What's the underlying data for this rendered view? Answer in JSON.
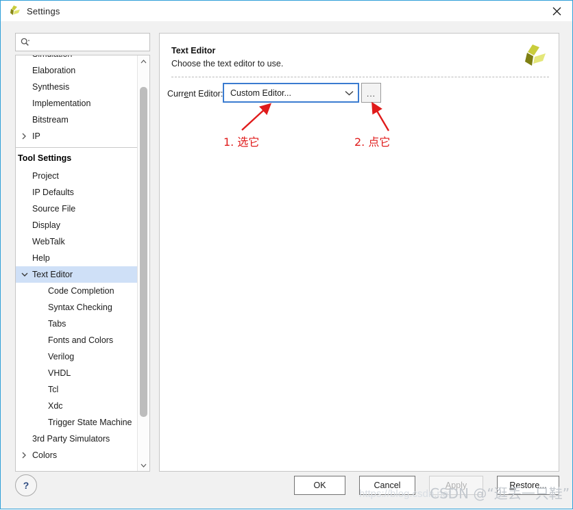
{
  "window": {
    "title": "Settings",
    "logo_icon": "vivado-logo-icon",
    "close_icon": "close-icon",
    "accent_color": "#2f9fd8"
  },
  "search": {
    "icon": "search-icon",
    "value": "",
    "placeholder": ""
  },
  "sidebar": {
    "items": [
      {
        "label": "Simulation",
        "level": 1,
        "type": "item",
        "chevron": "",
        "selected": false
      },
      {
        "label": "Elaboration",
        "level": 1,
        "type": "item",
        "chevron": "",
        "selected": false
      },
      {
        "label": "Synthesis",
        "level": 1,
        "type": "item",
        "chevron": "",
        "selected": false
      },
      {
        "label": "Implementation",
        "level": 1,
        "type": "item",
        "chevron": "",
        "selected": false
      },
      {
        "label": "Bitstream",
        "level": 1,
        "type": "item",
        "chevron": "",
        "selected": false
      },
      {
        "label": "IP",
        "level": 1,
        "type": "item",
        "chevron": "right",
        "selected": false
      },
      {
        "label": "Tool Settings",
        "level": 0,
        "type": "header",
        "chevron": "",
        "selected": false
      },
      {
        "label": "Project",
        "level": 1,
        "type": "item",
        "chevron": "",
        "selected": false
      },
      {
        "label": "IP Defaults",
        "level": 1,
        "type": "item",
        "chevron": "",
        "selected": false
      },
      {
        "label": "Source File",
        "level": 1,
        "type": "item",
        "chevron": "",
        "selected": false
      },
      {
        "label": "Display",
        "level": 1,
        "type": "item",
        "chevron": "",
        "selected": false
      },
      {
        "label": "WebTalk",
        "level": 1,
        "type": "item",
        "chevron": "",
        "selected": false
      },
      {
        "label": "Help",
        "level": 1,
        "type": "item",
        "chevron": "",
        "selected": false
      },
      {
        "label": "Text Editor",
        "level": 1,
        "type": "item",
        "chevron": "down",
        "selected": true
      },
      {
        "label": "Code Completion",
        "level": 2,
        "type": "item",
        "chevron": "",
        "selected": false
      },
      {
        "label": "Syntax Checking",
        "level": 2,
        "type": "item",
        "chevron": "",
        "selected": false
      },
      {
        "label": "Tabs",
        "level": 2,
        "type": "item",
        "chevron": "",
        "selected": false
      },
      {
        "label": "Fonts and Colors",
        "level": 2,
        "type": "item",
        "chevron": "",
        "selected": false
      },
      {
        "label": "Verilog",
        "level": 2,
        "type": "item",
        "chevron": "",
        "selected": false
      },
      {
        "label": "VHDL",
        "level": 2,
        "type": "item",
        "chevron": "",
        "selected": false
      },
      {
        "label": "Tcl",
        "level": 2,
        "type": "item",
        "chevron": "",
        "selected": false
      },
      {
        "label": "Xdc",
        "level": 2,
        "type": "item",
        "chevron": "",
        "selected": false
      },
      {
        "label": "Trigger State Machine",
        "level": 2,
        "type": "item",
        "chevron": "",
        "selected": false
      },
      {
        "label": "3rd Party Simulators",
        "level": 1,
        "type": "item",
        "chevron": "",
        "selected": false
      },
      {
        "label": "Colors",
        "level": 1,
        "type": "item",
        "chevron": "right",
        "selected": false
      }
    ],
    "selection_color": "#cfe0f7"
  },
  "help_button": {
    "label": "?"
  },
  "main": {
    "title": "Text Editor",
    "subtitle": "Choose the text editor to use.",
    "logo_icon": "xilinx-logo-icon",
    "field": {
      "label_before": "Curr",
      "label_mnemonic": "e",
      "label_after": "nt Editor:",
      "combo_value": "Custom Editor...",
      "combo_arrow_icon": "chevron-down-icon",
      "focus_color": "#3a7bd0",
      "ellipsis_label": "..."
    }
  },
  "annotations": {
    "color": "#e01b1b",
    "items": [
      {
        "text": "1. 选它",
        "target": "current-editor-combo"
      },
      {
        "text": "2. 点它",
        "target": "browse-ellipsis-button"
      }
    ]
  },
  "footer": {
    "buttons": [
      {
        "id": "ok",
        "label": "OK",
        "mnemonic": "",
        "enabled": true
      },
      {
        "id": "cancel",
        "label": "Cancel",
        "mnemonic": "",
        "enabled": true
      },
      {
        "id": "apply",
        "label": "Apply",
        "mnemonic": "A",
        "enabled": false
      },
      {
        "id": "restore",
        "label": "Restore...",
        "mnemonic": "R",
        "enabled": true
      }
    ]
  },
  "watermark": {
    "url": "https://blog.csdn.net",
    "text": "CSDN @“逛丢一只鞋”"
  }
}
